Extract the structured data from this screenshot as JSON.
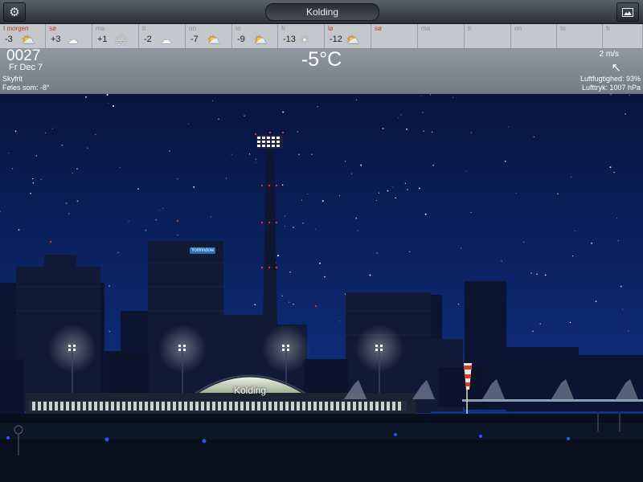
{
  "toolbar": {
    "settings_icon": "gear-icon",
    "image_icon": "picture-icon",
    "location": "Kolding"
  },
  "forecast": [
    {
      "day": "I morgen",
      "temp": "-3",
      "icon": "sun-cloud-icon",
      "glyph": "⛅",
      "weekend": true
    },
    {
      "day": "sø",
      "temp": "+3",
      "icon": "cloud-icon",
      "glyph": "☁",
      "weekend": true
    },
    {
      "day": "ma",
      "temp": "+1",
      "icon": "cloud-snow-icon",
      "glyph": "🌨",
      "weekend": false
    },
    {
      "day": "ti",
      "temp": "-2",
      "icon": "cloud-icon",
      "glyph": "☁",
      "weekend": false
    },
    {
      "day": "on",
      "temp": "-7",
      "icon": "sun-cloud-icon",
      "glyph": "⛅",
      "weekend": false
    },
    {
      "day": "to",
      "temp": "-9",
      "icon": "sun-cloud-icon",
      "glyph": "⛅",
      "weekend": false
    },
    {
      "day": "fr",
      "temp": "-13",
      "icon": "sun-icon",
      "glyph": "☀",
      "weekend": false
    },
    {
      "day": "lø",
      "temp": "-12",
      "icon": "sun-cloud-icon",
      "glyph": "⛅",
      "weekend": true
    },
    {
      "day": "sø",
      "temp": "",
      "icon": "",
      "glyph": "",
      "weekend": true
    },
    {
      "day": "ma",
      "temp": "",
      "icon": "",
      "glyph": "",
      "weekend": false
    },
    {
      "day": "ti",
      "temp": "",
      "icon": "",
      "glyph": "",
      "weekend": false
    },
    {
      "day": "on",
      "temp": "",
      "icon": "",
      "glyph": "",
      "weekend": false
    },
    {
      "day": "to",
      "temp": "",
      "icon": "",
      "glyph": "",
      "weekend": false
    },
    {
      "day": "fr",
      "temp": "",
      "icon": "",
      "glyph": "",
      "weekend": false
    }
  ],
  "current": {
    "time": "0027",
    "date": "Fr Dec 7",
    "sky": "Skyfrit",
    "feels_like": "Føles som: -8°",
    "temperature": "-5°C",
    "wind": "2 m/s",
    "wind_icon": "wind-direction-arrow-icon",
    "humidity": "Luftfugtighed: 93%",
    "pressure": "Lufttryk: 1007 hPa"
  },
  "scene": {
    "station_label": "Kolding",
    "sign_text": "YoWindow"
  },
  "colors": {
    "sky_top": "#08143f",
    "sky_bottom": "#12368a",
    "weekend_text": "#c0392b",
    "weekday_text": "#8a9096"
  }
}
